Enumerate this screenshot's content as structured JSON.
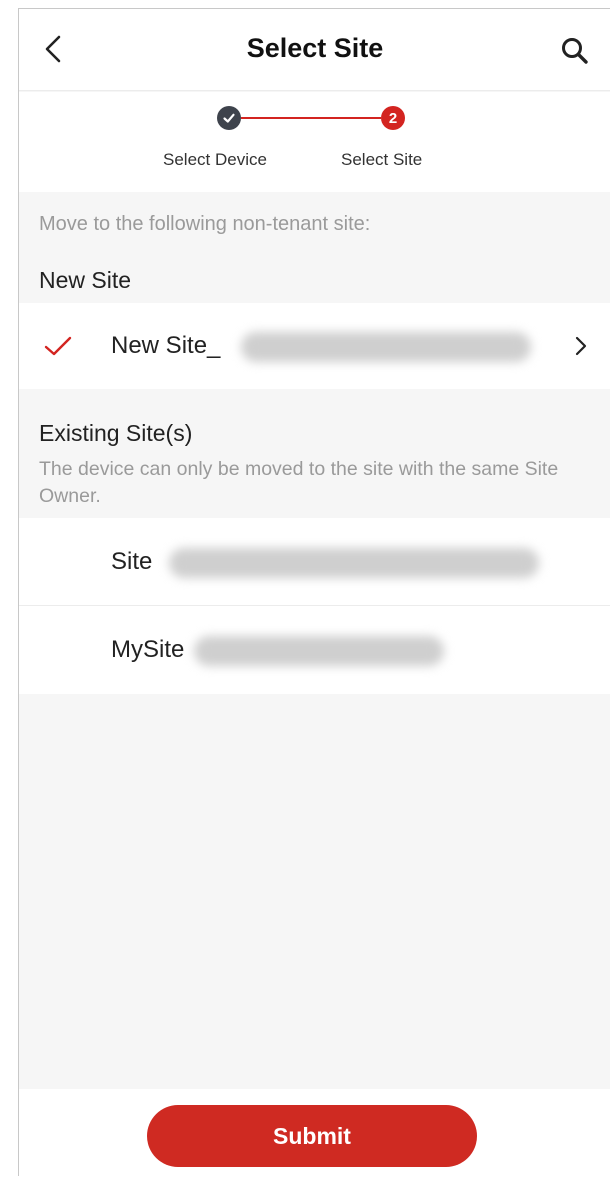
{
  "header": {
    "title": "Select Site"
  },
  "stepper": {
    "steps": [
      {
        "label": "Select Device",
        "state": "completed"
      },
      {
        "label": "Select Site",
        "state": "active",
        "number": "2"
      }
    ]
  },
  "hint": "Move to the following non-tenant site:",
  "new_site_section": {
    "title": "New Site",
    "item": {
      "label": "New Site_",
      "selected": true
    }
  },
  "existing_section": {
    "title": "Existing Site(s)",
    "note": "The device can only be moved to the site with the same Site Owner.",
    "items": [
      {
        "label": "Site"
      },
      {
        "label": "MySite"
      }
    ]
  },
  "submit_label": "Submit",
  "colors": {
    "accent": "#d32420",
    "step_done": "#3e434c",
    "hint_text": "#9a9a9a",
    "background": "#f6f6f6"
  },
  "icons": [
    "chevron-left-icon",
    "search-icon",
    "check-icon",
    "chevron-right-icon"
  ]
}
